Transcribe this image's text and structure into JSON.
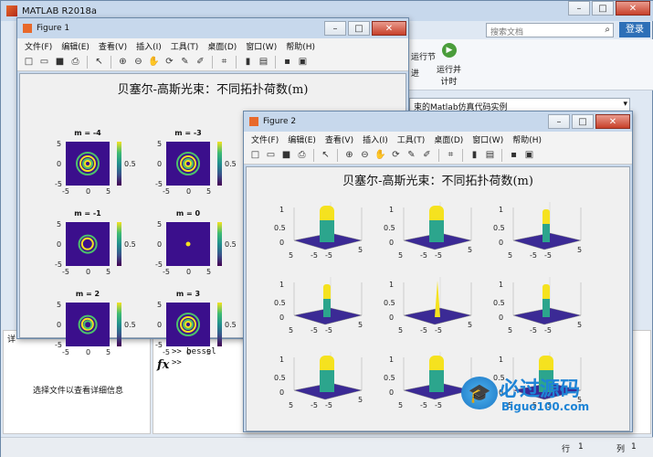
{
  "app": {
    "title": "MATLAB R2018a",
    "search_placeholder": "搜索文档",
    "login": "登录"
  },
  "ribbon": {
    "run_section": "运行节",
    "advance": "进",
    "run_time": "运行并\n计时"
  },
  "path": {
    "value": "束的Matlab仿真代码实例"
  },
  "left": {
    "details_placeholder": "选择文件以查看详细信息",
    "panel_label": "详"
  },
  "cmd": {
    "lines": [
      ">> bessel",
      ">>"
    ],
    "fx": "fx"
  },
  "status": {
    "row_label": "行",
    "row": "1",
    "col_label": "列",
    "col": "1"
  },
  "watermark": {
    "brand": "必过源码",
    "url": "Biguo100.com"
  },
  "menus": [
    "文件(F)",
    "编辑(E)",
    "查看(V)",
    "插入(I)",
    "工具(T)",
    "桌面(D)",
    "窗口(W)",
    "帮助(H)"
  ],
  "fig1": {
    "title": "Figure 1",
    "heading": "贝塞尔-高斯光束：不同拓扑荷数(m)",
    "plots": [
      {
        "label": "m = -4",
        "cb": "0.5",
        "ticks": [
          "5",
          "0",
          "-5",
          "-5",
          "0",
          "5"
        ],
        "rings": 4
      },
      {
        "label": "m = -3",
        "cb": "0.5",
        "ticks": [
          "5",
          "0",
          "-5",
          "-5",
          "0",
          "5"
        ],
        "rings": 3
      },
      {
        "label": "m = -2",
        "cb": "",
        "ticks": [],
        "rings": 0
      },
      {
        "label": "m = -1",
        "cb": "0.5",
        "ticks": [
          "5",
          "0",
          "-5",
          "-5",
          "0",
          "5"
        ],
        "rings": 1
      },
      {
        "label": "m = 0",
        "cb": "0.5",
        "ticks": [
          "5",
          "0",
          "-5",
          "-5",
          "0",
          "5"
        ],
        "rings": 0
      },
      {
        "label": "",
        "cb": "",
        "ticks": [],
        "rings": 0
      },
      {
        "label": "m = 2",
        "cb": "0.5",
        "ticks": [
          "5",
          "0",
          "-5",
          "-5",
          "0",
          "5"
        ],
        "rings": 2
      },
      {
        "label": "m = 3",
        "cb": "0.5",
        "ticks": [
          "5",
          "0",
          "-5",
          "-5",
          "0",
          "5"
        ],
        "rings": 3
      }
    ]
  },
  "fig2": {
    "title": "Figure 2",
    "heading": "贝塞尔-高斯光束：不同拓扑荷数(m)",
    "zticks": [
      "1",
      "0.5",
      "0"
    ],
    "xticks": [
      "-5",
      "5"
    ],
    "yticks": [
      "0",
      "-5",
      "5"
    ],
    "count": 9
  },
  "colors": {
    "accent": "#2d6fb7",
    "viridis_low": "#3b0f8c",
    "viridis_high": "#f5e21f"
  }
}
